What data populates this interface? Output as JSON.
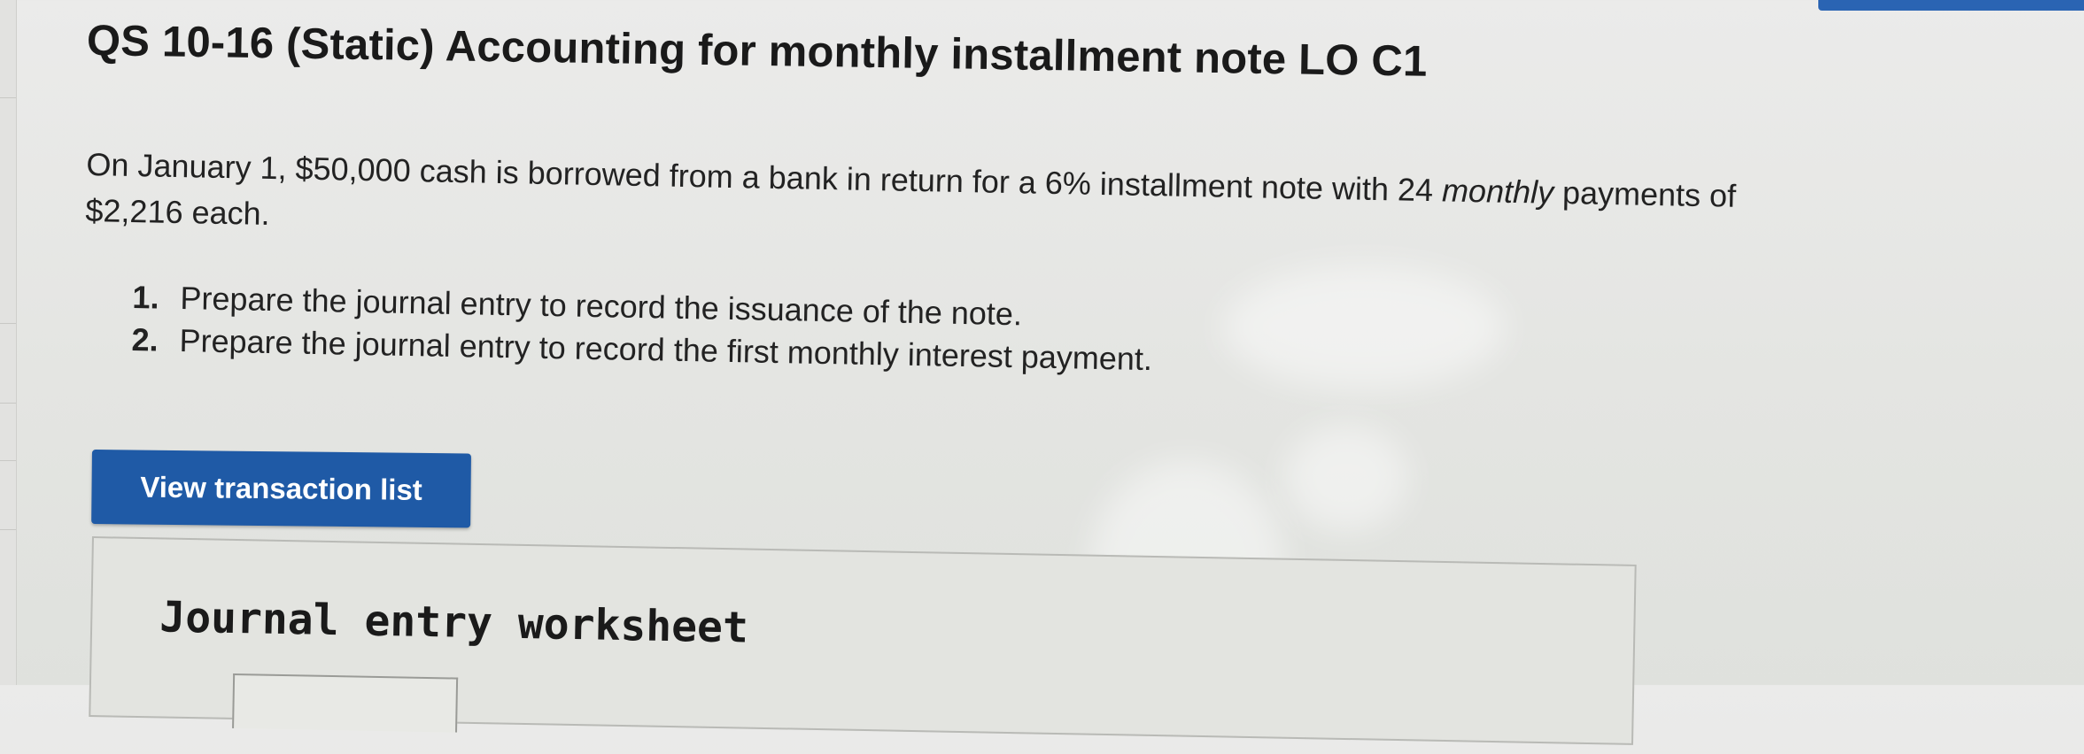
{
  "question": {
    "title": "QS 10-16 (Static) Accounting for monthly installment note LO C1",
    "problem_line1": "On January 1, $50,000 cash is borrowed from a bank in return for a 6% installment note with 24 ",
    "problem_emphasis": "monthly",
    "problem_line1_end": " payments of",
    "problem_line2": "$2,216 each.",
    "steps": [
      {
        "number": "1.",
        "text": "Prepare the journal entry to record the issuance of the note."
      },
      {
        "number": "2.",
        "text": "Prepare the journal entry to record the first monthly interest payment."
      }
    ]
  },
  "actions": {
    "view_transaction_list_label": "View transaction list"
  },
  "worksheet": {
    "heading": "Journal entry worksheet"
  },
  "colors": {
    "button_bg": "#1f5aa6",
    "accent_bar": "#2a64b3",
    "page_bg": "#e6e7e4"
  }
}
